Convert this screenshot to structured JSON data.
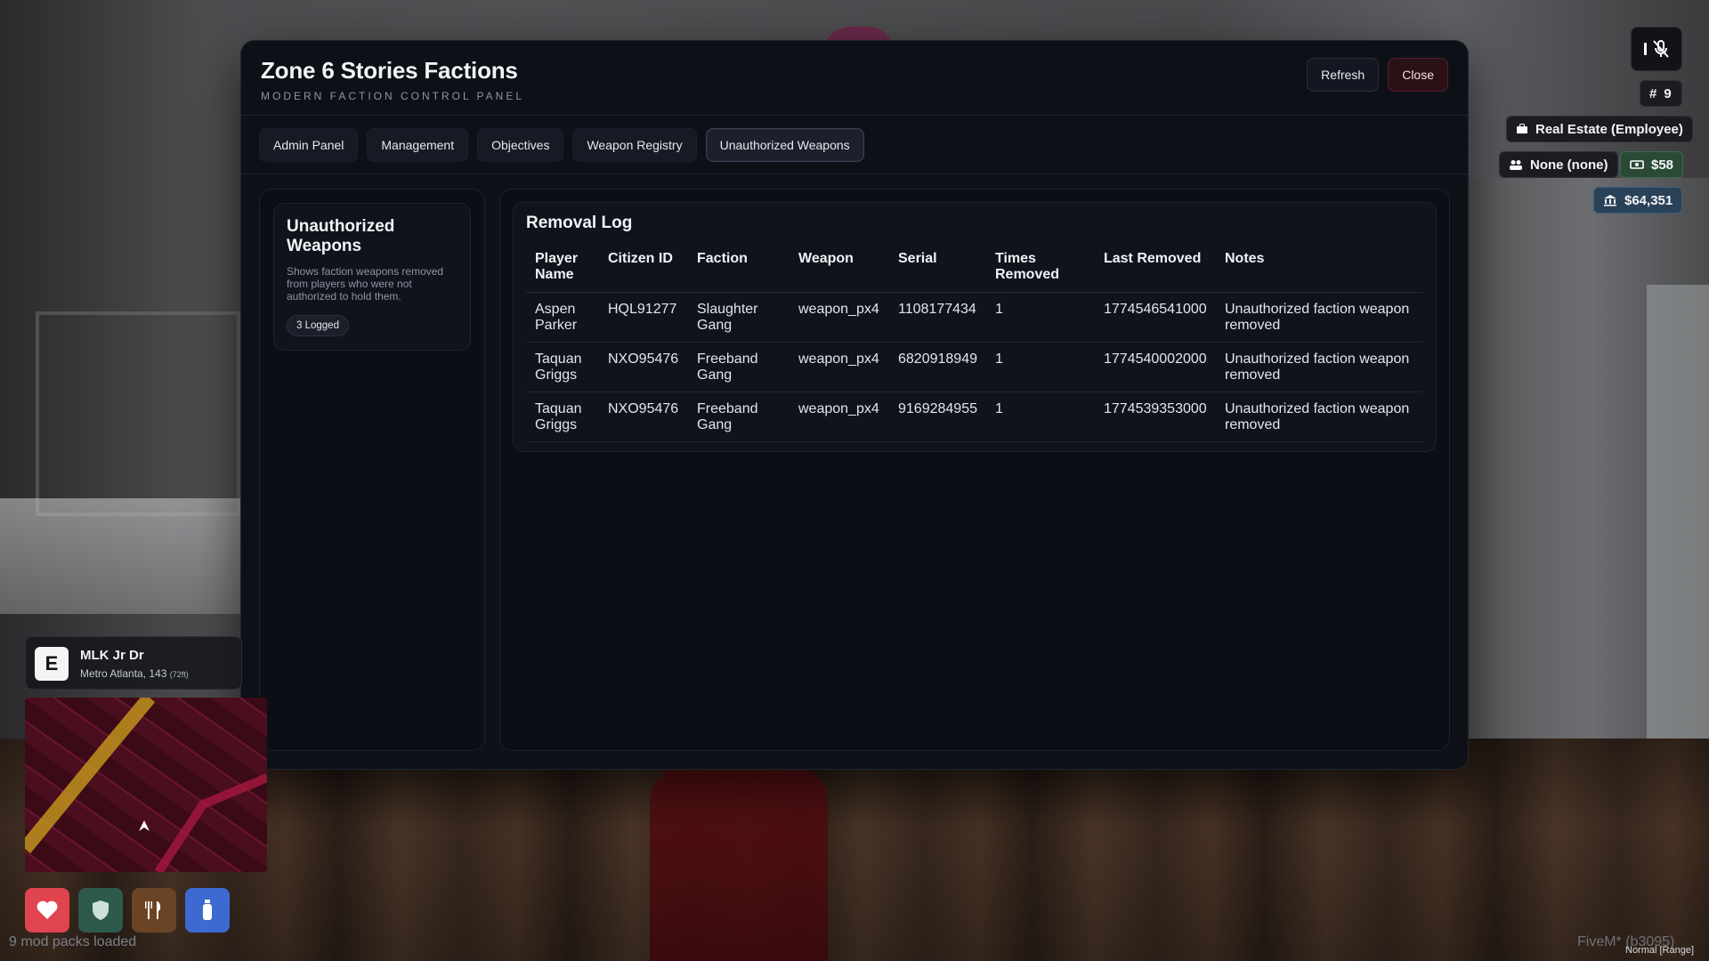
{
  "panel": {
    "title": "Zone 6 Stories Factions",
    "subtitle": "MODERN FACTION CONTROL PANEL",
    "refresh_label": "Refresh",
    "close_label": "Close"
  },
  "tabs": [
    {
      "label": "Admin Panel",
      "active": false
    },
    {
      "label": "Management",
      "active": false
    },
    {
      "label": "Objectives",
      "active": false
    },
    {
      "label": "Weapon Registry",
      "active": false
    },
    {
      "label": "Unauthorized Weapons",
      "active": true
    }
  ],
  "sidebar": {
    "title": "Unauthorized Weapons",
    "description": "Shows faction weapons removed from players who were not authorized to hold them.",
    "badge": "3 Logged"
  },
  "log": {
    "title": "Removal Log",
    "columns": [
      "Player Name",
      "Citizen ID",
      "Faction",
      "Weapon",
      "Serial",
      "Times Removed",
      "Last Removed",
      "Notes"
    ],
    "rows": [
      [
        "Aspen Parker",
        "HQL91277",
        "Slaughter Gang",
        "weapon_px4",
        "1108177434",
        "1",
        "1774546541000",
        "Unauthorized faction weapon removed"
      ],
      [
        "Taquan Griggs",
        "NXO95476",
        "Freeband Gang",
        "weapon_px4",
        "6820918949",
        "1",
        "1774540002000",
        "Unauthorized faction weapon removed"
      ],
      [
        "Taquan Griggs",
        "NXO95476",
        "Freeband Gang",
        "weapon_px4",
        "9169284955",
        "1",
        "1774539353000",
        "Unauthorized faction weapon removed"
      ]
    ]
  },
  "hud": {
    "id_number": "9",
    "job": "Real Estate (Employee)",
    "gang": "None (none)",
    "cash": "$58",
    "bank": "$64,351",
    "street_letter": "E",
    "street_name": "MLK Jr Dr",
    "street_area": "Metro Atlanta, 143",
    "street_dist": "(72ft)",
    "mods_loaded": "9 mod packs loaded",
    "fivem_build": "FiveM* (b3095)",
    "voice_range": "Normal [Range]"
  },
  "colors": {
    "health": "#e0444f",
    "armor": "#2d5a4c",
    "hunger": "#6a4424",
    "thirst": "#3c6ad0"
  },
  "icons": {
    "mic": "mic-muted-icon",
    "id": "hash-icon",
    "job": "briefcase-icon",
    "gang": "users-icon",
    "cash": "cash-icon",
    "bank": "bank-icon",
    "health": "heart-icon",
    "armor": "shield-icon",
    "hunger": "fork-knife-icon",
    "thirst": "bottle-icon"
  }
}
